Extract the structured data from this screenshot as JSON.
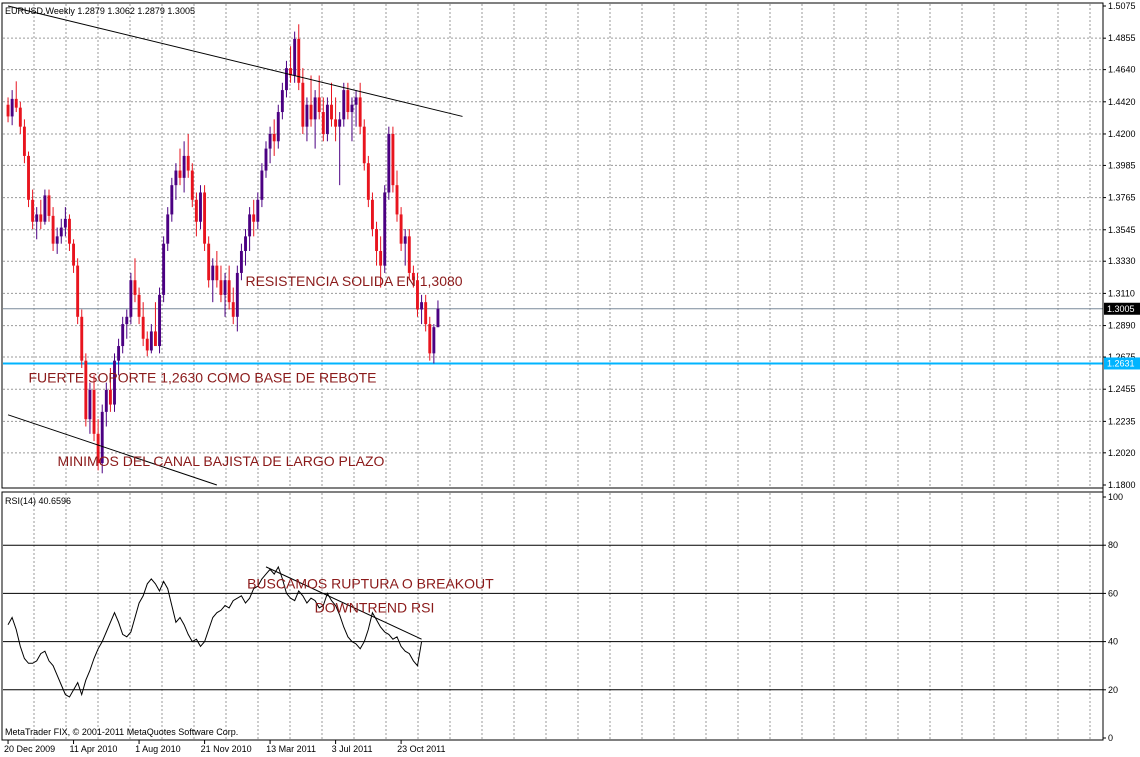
{
  "colors": {
    "background": "#ffffff",
    "bull_candle": "#4b0082",
    "bear_candle": "#e8141e",
    "grid": "#9a9a9a",
    "support_line": "#00b4ff",
    "annotation": "#8b1a1a",
    "rsi_line": "#000000",
    "trendline": "#000000"
  },
  "header": {
    "title": "EURUSD,Weekly  1.2879 1.3062 1.2879 1.3005"
  },
  "footer": {
    "copyright": "MetaTrader FIX, © 2001-2011 MetaQuotes Software Corp."
  },
  "chart_data": [
    {
      "type": "candlestick",
      "symbol": "EURUSD",
      "timeframe": "Weekly",
      "y_ticks": [
        "1.5075",
        "1.4855",
        "1.4640",
        "1.4420",
        "1.4200",
        "1.3985",
        "1.3765",
        "1.3545",
        "1.3330",
        "1.3110",
        "1.2890",
        "1.2675",
        "1.2455",
        "1.2235",
        "1.2020",
        "1.1800"
      ],
      "ylim": [
        1.18,
        1.5075
      ],
      "price_labels": [
        {
          "value": 1.3005,
          "text": "1.3005",
          "style": "current"
        },
        {
          "value": 1.2631,
          "text": "1.2631",
          "style": "support"
        }
      ],
      "support_level": 1.2631,
      "current_price": 1.3005,
      "x_labels": [
        "20 Dec 2009",
        "11 Apr 2010",
        "1 Aug 2010",
        "21 Nov 2010",
        "13 Mar 2011",
        "3 Jul 2011",
        "23 Oct 2011"
      ],
      "candles": [
        [
          1.44,
          1.445,
          1.428,
          1.432
        ],
        [
          1.432,
          1.45,
          1.426,
          1.444
        ],
        [
          1.444,
          1.456,
          1.435,
          1.438
        ],
        [
          1.438,
          1.442,
          1.42,
          1.425
        ],
        [
          1.425,
          1.43,
          1.4,
          1.405
        ],
        [
          1.405,
          1.408,
          1.37,
          1.375
        ],
        [
          1.375,
          1.382,
          1.355,
          1.36
        ],
        [
          1.36,
          1.37,
          1.348,
          1.365
        ],
        [
          1.365,
          1.375,
          1.355,
          1.36
        ],
        [
          1.36,
          1.382,
          1.358,
          1.378
        ],
        [
          1.378,
          1.382,
          1.36,
          1.364
        ],
        [
          1.364,
          1.37,
          1.34,
          1.345
        ],
        [
          1.345,
          1.356,
          1.338,
          1.35
        ],
        [
          1.35,
          1.362,
          1.345,
          1.356
        ],
        [
          1.356,
          1.37,
          1.35,
          1.362
        ],
        [
          1.362,
          1.365,
          1.34,
          1.345
        ],
        [
          1.345,
          1.348,
          1.325,
          1.33
        ],
        [
          1.33,
          1.335,
          1.29,
          1.295
        ],
        [
          1.295,
          1.3,
          1.26,
          1.265
        ],
        [
          1.265,
          1.27,
          1.22,
          1.225
        ],
        [
          1.225,
          1.25,
          1.215,
          1.245
        ],
        [
          1.245,
          1.255,
          1.21,
          1.215
        ],
        [
          1.215,
          1.225,
          1.19,
          1.195
        ],
        [
          1.195,
          1.235,
          1.188,
          1.23
        ],
        [
          1.23,
          1.25,
          1.22,
          1.245
        ],
        [
          1.245,
          1.26,
          1.23,
          1.235
        ],
        [
          1.235,
          1.27,
          1.23,
          1.265
        ],
        [
          1.265,
          1.28,
          1.255,
          1.275
        ],
        [
          1.275,
          1.295,
          1.27,
          1.29
        ],
        [
          1.29,
          1.3,
          1.28,
          1.295
        ],
        [
          1.295,
          1.325,
          1.29,
          1.32
        ],
        [
          1.32,
          1.335,
          1.305,
          1.31
        ],
        [
          1.31,
          1.315,
          1.29,
          1.295
        ],
        [
          1.295,
          1.305,
          1.275,
          1.28
        ],
        [
          1.28,
          1.285,
          1.268,
          1.272
        ],
        [
          1.272,
          1.29,
          1.27,
          1.285
        ],
        [
          1.285,
          1.305,
          1.28,
          1.275
        ],
        [
          1.275,
          1.315,
          1.27,
          1.31
        ],
        [
          1.31,
          1.35,
          1.305,
          1.345
        ],
        [
          1.345,
          1.37,
          1.34,
          1.365
        ],
        [
          1.365,
          1.39,
          1.36,
          1.385
        ],
        [
          1.385,
          1.4,
          1.375,
          1.395
        ],
        [
          1.395,
          1.41,
          1.385,
          1.39
        ],
        [
          1.39,
          1.415,
          1.38,
          1.405
        ],
        [
          1.405,
          1.42,
          1.39,
          1.395
        ],
        [
          1.395,
          1.4,
          1.37,
          1.375
        ],
        [
          1.375,
          1.38,
          1.35,
          1.36
        ],
        [
          1.36,
          1.385,
          1.355,
          1.38
        ],
        [
          1.38,
          1.385,
          1.34,
          1.345
        ],
        [
          1.345,
          1.35,
          1.315,
          1.32
        ],
        [
          1.32,
          1.335,
          1.305,
          1.33
        ],
        [
          1.33,
          1.34,
          1.315,
          1.32
        ],
        [
          1.32,
          1.33,
          1.305,
          1.31
        ],
        [
          1.31,
          1.325,
          1.295,
          1.32
        ],
        [
          1.32,
          1.33,
          1.3,
          1.305
        ],
        [
          1.305,
          1.315,
          1.29,
          1.295
        ],
        [
          1.295,
          1.33,
          1.285,
          1.325
        ],
        [
          1.325,
          1.345,
          1.32,
          1.34
        ],
        [
          1.34,
          1.355,
          1.33,
          1.35
        ],
        [
          1.35,
          1.37,
          1.34,
          1.365
        ],
        [
          1.365,
          1.375,
          1.35,
          1.36
        ],
        [
          1.36,
          1.38,
          1.355,
          1.375
        ],
        [
          1.375,
          1.4,
          1.37,
          1.395
        ],
        [
          1.395,
          1.415,
          1.39,
          1.41
        ],
        [
          1.41,
          1.425,
          1.4,
          1.42
        ],
        [
          1.42,
          1.43,
          1.405,
          1.415
        ],
        [
          1.415,
          1.44,
          1.41,
          1.435
        ],
        [
          1.435,
          1.455,
          1.43,
          1.45
        ],
        [
          1.45,
          1.47,
          1.445,
          1.465
        ],
        [
          1.465,
          1.48,
          1.455,
          1.46
        ],
        [
          1.46,
          1.49,
          1.455,
          1.485
        ],
        [
          1.485,
          1.495,
          1.45,
          1.455
        ],
        [
          1.455,
          1.465,
          1.42,
          1.425
        ],
        [
          1.425,
          1.445,
          1.415,
          1.44
        ],
        [
          1.44,
          1.46,
          1.425,
          1.43
        ],
        [
          1.43,
          1.45,
          1.41,
          1.445
        ],
        [
          1.445,
          1.46,
          1.43,
          1.435
        ],
        [
          1.435,
          1.445,
          1.415,
          1.42
        ],
        [
          1.42,
          1.445,
          1.415,
          1.44
        ],
        [
          1.44,
          1.455,
          1.425,
          1.43
        ],
        [
          1.43,
          1.445,
          1.415,
          1.425
        ],
        [
          1.425,
          1.435,
          1.385,
          1.43
        ],
        [
          1.43,
          1.455,
          1.425,
          1.45
        ],
        [
          1.45,
          1.455,
          1.43,
          1.435
        ],
        [
          1.435,
          1.445,
          1.415,
          1.44
        ],
        [
          1.44,
          1.45,
          1.425,
          1.445
        ],
        [
          1.445,
          1.455,
          1.42,
          1.425
        ],
        [
          1.425,
          1.43,
          1.395,
          1.4
        ],
        [
          1.4,
          1.405,
          1.37,
          1.375
        ],
        [
          1.375,
          1.38,
          1.35,
          1.355
        ],
        [
          1.355,
          1.36,
          1.33,
          1.34
        ],
        [
          1.34,
          1.35,
          1.315,
          1.33
        ],
        [
          1.33,
          1.385,
          1.325,
          1.38
        ],
        [
          1.38,
          1.425,
          1.375,
          1.42
        ],
        [
          1.42,
          1.425,
          1.38,
          1.385
        ],
        [
          1.385,
          1.395,
          1.36,
          1.365
        ],
        [
          1.365,
          1.37,
          1.34,
          1.345
        ],
        [
          1.345,
          1.355,
          1.33,
          1.35
        ],
        [
          1.35,
          1.355,
          1.32,
          1.325
        ],
        [
          1.325,
          1.33,
          1.315,
          1.32
        ],
        [
          1.32,
          1.325,
          1.295,
          1.3
        ],
        [
          1.3,
          1.31,
          1.29,
          1.305
        ],
        [
          1.305,
          1.31,
          1.285,
          1.29
        ],
        [
          1.29,
          1.295,
          1.265,
          1.27
        ],
        [
          1.27,
          1.29,
          1.2631,
          1.2879
        ],
        [
          1.2879,
          1.3062,
          1.2879,
          1.3005
        ]
      ],
      "trendlines": [
        {
          "name": "resistance-channel",
          "points": [
            [
              0,
              1.5075
            ],
            [
              111,
              1.432
            ]
          ]
        },
        {
          "name": "support-channel",
          "points": [
            [
              0,
              1.228
            ],
            [
              51,
              1.18
            ]
          ]
        }
      ],
      "annotations": [
        {
          "text": "RESISTENCIA SOLIDA EN 1,3080",
          "x_index": 84.5,
          "y": 1.316
        },
        {
          "text": "FUERTE SOPORTE 1,2630 COMO BASE DE REBOTE",
          "x_index": 47.5,
          "y": 1.25
        },
        {
          "text": "MINIMOS DEL CANAL BAJISTA DE LARGO PLAZO",
          "x_index": 52.0,
          "y": 1.193
        }
      ]
    },
    {
      "type": "line",
      "indicator": "RSI(14)",
      "label": "RSI(14) 40.6596",
      "ylim": [
        0,
        100
      ],
      "y_ticks": [
        "100",
        "80",
        "60",
        "40",
        "20",
        "0"
      ],
      "levels": [
        80,
        60,
        40,
        20
      ],
      "series": [
        {
          "values": [
            47,
            50,
            45,
            38,
            33,
            31,
            31,
            32,
            35,
            36,
            32,
            30,
            26,
            22,
            18,
            17,
            20,
            23,
            18,
            24,
            28,
            33,
            37,
            40,
            44,
            48,
            52,
            48,
            43,
            42,
            44,
            50,
            56,
            59,
            64,
            66,
            64,
            61,
            65,
            62,
            55,
            48,
            50,
            47,
            43,
            40,
            41,
            38,
            40,
            45,
            50,
            52,
            53,
            55,
            54,
            57,
            58,
            59,
            56,
            58,
            62,
            63,
            66,
            68,
            70,
            68,
            71,
            66,
            60,
            58,
            57,
            61,
            59,
            56,
            58,
            57,
            54,
            55,
            60,
            57,
            55,
            51,
            46,
            42,
            40,
            39,
            37,
            40,
            45,
            52,
            49,
            46,
            44,
            43,
            41,
            42,
            38,
            36,
            35,
            32,
            30,
            40
          ]
        }
      ],
      "trendlines": [
        {
          "name": "rsi-downtrend",
          "points": [
            [
              63,
              71
            ],
            [
              101,
              41
            ]
          ]
        }
      ],
      "annotations": [
        {
          "text": "BUSCAMOS RUPTURA O BREAKOUT",
          "x_index": 88.5,
          "y": 62
        },
        {
          "text": "DOWNTREND RSI",
          "x_index": 89.5,
          "y": 52
        }
      ]
    }
  ]
}
